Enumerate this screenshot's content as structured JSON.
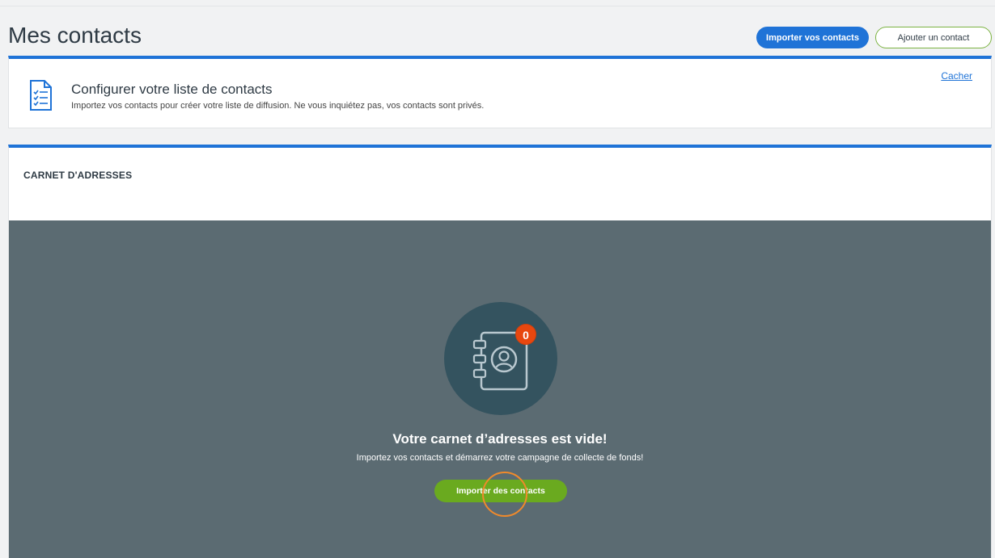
{
  "page": {
    "title": "Mes contacts"
  },
  "header": {
    "import_button": "Importer vos contacts",
    "add_button": "Ajouter un contact"
  },
  "setup": {
    "title": "Configurer votre liste de contacts",
    "description": "Importez vos contacts pour créer votre liste de diffusion. Ne vous inquiétez pas, vos contacts sont privés.",
    "hide_link": "Cacher",
    "icon": "checklist-document-icon"
  },
  "address_book": {
    "header": "CARNET D'ADRESSES",
    "badge_count": "0",
    "icon": "address-book-icon",
    "empty_title": "Votre carnet d’adresses est vide!",
    "empty_description": "Importez vos contacts et démarrez votre campagne de collecte de fonds!",
    "import_button": "Importer des contacts"
  },
  "colors": {
    "primary_blue": "#1f73d7",
    "accent_green": "#6aaa1f",
    "empty_bg": "#5b6b72",
    "circle_bg": "#34535f",
    "badge_red": "#e8470f",
    "click_ring": "#f08a2b"
  }
}
